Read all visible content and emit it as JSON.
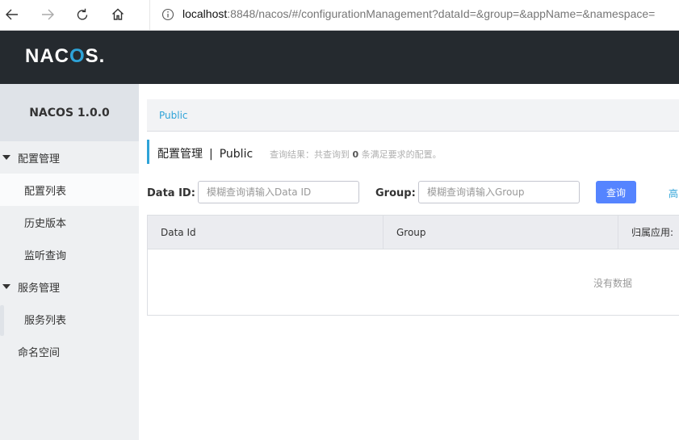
{
  "browser": {
    "url_host": "localhost",
    "url_rest": ":8848/nacos/#/configurationManagement?dataId=&group=&appName=&namespace="
  },
  "header": {
    "logo_left": "NAC",
    "logo_o": "O",
    "logo_right": "S."
  },
  "sidebar": {
    "title": "NACOS 1.0.0",
    "groups": [
      {
        "label": "配置管理",
        "items": [
          "配置列表",
          "历史版本",
          "监听查询"
        ]
      },
      {
        "label": "服务管理",
        "items": [
          "服务列表"
        ]
      }
    ],
    "namespace": "命名空间"
  },
  "main": {
    "breadcrumb": "Public",
    "page_title": "配置管理",
    "page_title_sep": "|",
    "page_namespace": "Public",
    "result_prefix": "查询结果：共查询到",
    "result_count": "0",
    "result_suffix": "条满足要求的配置。",
    "dataid_label": "Data ID:",
    "dataid_placeholder": "模糊查询请输入Data ID",
    "group_label": "Group:",
    "group_placeholder": "模糊查询请输入Group",
    "query_button": "查询",
    "advanced_link": "高",
    "table": {
      "columns": [
        "Data Id",
        "Group",
        "归属应用:"
      ],
      "empty_text": "没有数据"
    }
  },
  "colors": {
    "accent": "#2ea3d8",
    "primary_button": "#5584ff",
    "header_bg": "#252a2f"
  }
}
